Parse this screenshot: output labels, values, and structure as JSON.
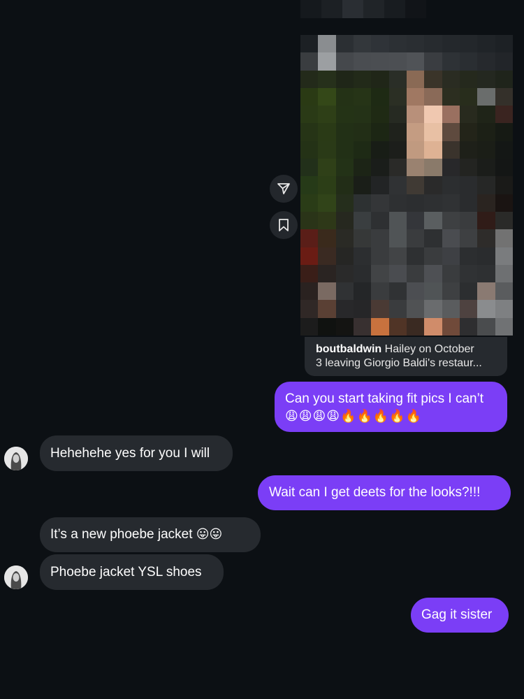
{
  "shared_post": {
    "caption_user": "boutbaldwin",
    "caption_line1": " Hailey on October",
    "caption_line2": "3 leaving Giorgio Baldi's restaur..."
  },
  "actions": {
    "share_icon": "paper-plane-icon",
    "save_icon": "bookmark-icon"
  },
  "messages": [
    {
      "from": "me",
      "text": "Can you start taking fit pics I can’t",
      "emojis": "😩😩😩😩🔥🔥🔥🔥🔥"
    },
    {
      "from": "them",
      "text": "Hehehehe yes for you I will"
    },
    {
      "from": "me",
      "text": "Wait can I get deets for the looks?!!!"
    },
    {
      "from": "them",
      "text": "It’s a new phoebe jacket ",
      "emojis": "😛😛"
    },
    {
      "from": "them",
      "text": "Phoebe jacket YSL shoes"
    },
    {
      "from": "me",
      "text": "Gag it sister"
    }
  ],
  "colors": {
    "background": "#0c1014",
    "outgoing_bubble": "#7b3ef6",
    "incoming_bubble": "#262a2f"
  }
}
